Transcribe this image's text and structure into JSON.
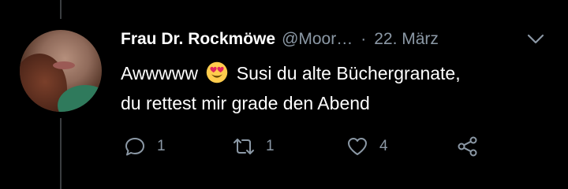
{
  "tweet": {
    "display_name": "Frau Dr. Rockmöwe",
    "handle": "@Moor…",
    "separator": "·",
    "date": "22. März",
    "text_line1_before_emoji": "Awwwww",
    "emoji": "heart-eyes-emoji",
    "text_line1_after_emoji": "Susi du alte Büchergranate,",
    "text_line2": "du rettest mir grade den Abend",
    "actions": {
      "reply_count": "1",
      "retweet_count": "1",
      "like_count": "4"
    }
  },
  "colors": {
    "background": "#000000",
    "primary_text": "#ffffff",
    "secondary_text": "#8b98a5",
    "thread_line": "#3a3d40"
  },
  "icons": [
    "reply-icon",
    "retweet-icon",
    "like-icon",
    "share-icon",
    "chevron-down-icon"
  ]
}
